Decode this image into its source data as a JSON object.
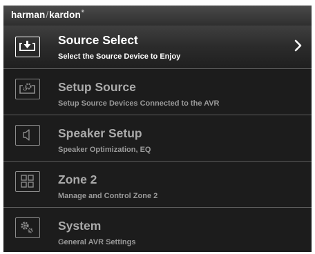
{
  "brand": {
    "part1": "harman",
    "separator": "/",
    "part2": "kardon",
    "trademark": "®"
  },
  "menu": [
    {
      "title": "Source Select",
      "subtitle": "Select the Source Device to Enjoy",
      "icon": "source-select-icon",
      "selected": true
    },
    {
      "title": "Setup Source",
      "subtitle": "Setup Source Devices Connected to the AVR",
      "icon": "setup-source-icon",
      "selected": false
    },
    {
      "title": "Speaker Setup",
      "subtitle": "Speaker Optimization, EQ",
      "icon": "speaker-icon",
      "selected": false
    },
    {
      "title": "Zone 2",
      "subtitle": "Manage and Control Zone 2",
      "icon": "zone-grid-icon",
      "selected": false
    },
    {
      "title": "System",
      "subtitle": "General AVR Settings",
      "icon": "gear-icon",
      "selected": false
    }
  ],
  "colors": {
    "background": "#1c1c1c",
    "selected_text": "#ffffff",
    "dim_text": "#aaaaaa",
    "separator": "#5e5e5e"
  }
}
